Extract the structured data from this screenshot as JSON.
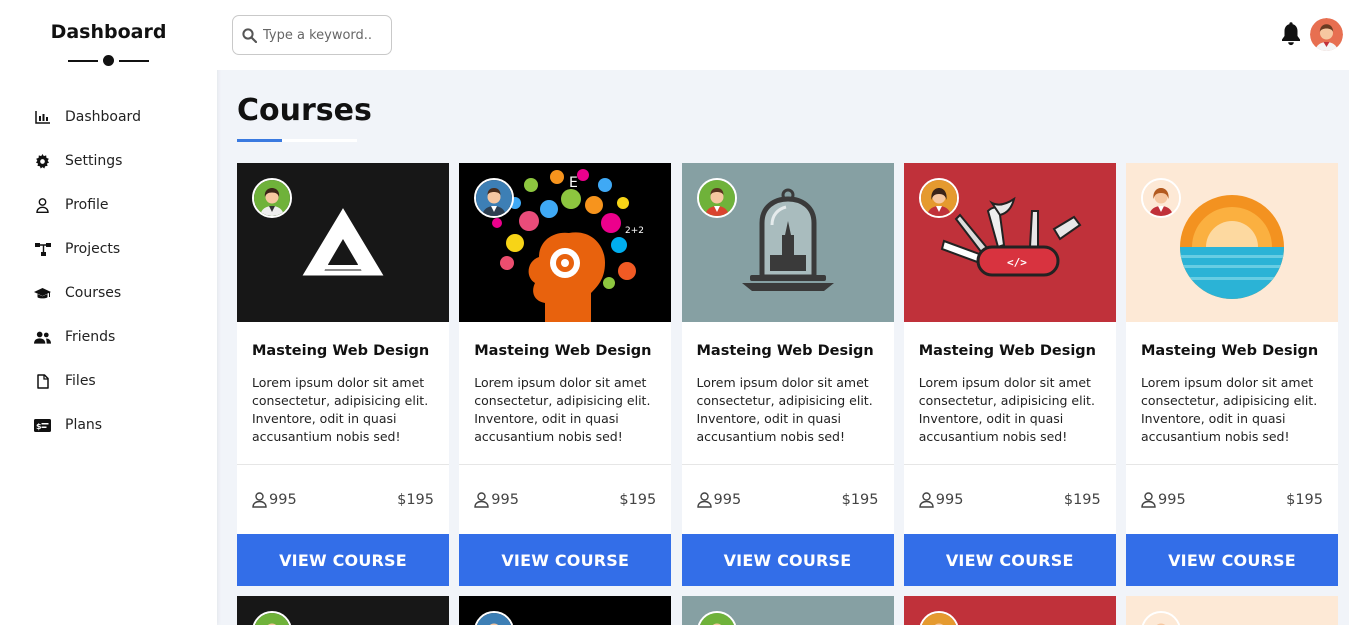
{
  "sidebar": {
    "brand": "Dashboard",
    "items": [
      {
        "label": "Dashboard",
        "icon": "bar-chart-icon"
      },
      {
        "label": "Settings",
        "icon": "gear-icon"
      },
      {
        "label": "Profile",
        "icon": "user-icon"
      },
      {
        "label": "Projects",
        "icon": "sitemap-icon"
      },
      {
        "label": "Courses",
        "icon": "graduation-cap-icon"
      },
      {
        "label": "Friends",
        "icon": "users-icon"
      },
      {
        "label": "Files",
        "icon": "file-icon"
      },
      {
        "label": "Plans",
        "icon": "credit-card-icon"
      }
    ]
  },
  "header": {
    "search_placeholder": "Type a keyword..",
    "notification_icon": "bell-icon",
    "avatar_icon": "user-avatar-icon"
  },
  "main": {
    "title": "Courses",
    "cards": [
      {
        "title": "Masteing Web Design",
        "description": "Lorem ipsum dolor sit amet consectetur, adipisicing elit. Inventore, odit in quasi accusantium nobis sed!",
        "students": "995",
        "price": "$195",
        "button": "VIEW COURSE",
        "theme": "#171717"
      },
      {
        "title": "Masteing Web Design",
        "description": "Lorem ipsum dolor sit amet consectetur, adipisicing elit. Inventore, odit in quasi accusantium nobis sed!",
        "students": "995",
        "price": "$195",
        "button": "VIEW COURSE",
        "theme": "#000000"
      },
      {
        "title": "Masteing Web Design",
        "description": "Lorem ipsum dolor sit amet consectetur, adipisicing elit. Inventore, odit in quasi accusantium nobis sed!",
        "students": "995",
        "price": "$195",
        "button": "VIEW COURSE",
        "theme": "#86a0a3"
      },
      {
        "title": "Masteing Web Design",
        "description": "Lorem ipsum dolor sit amet consectetur, adipisicing elit. Inventore, odit in quasi accusantium nobis sed!",
        "students": "995",
        "price": "$195",
        "button": "VIEW COURSE",
        "theme": "#c0313a"
      },
      {
        "title": "Masteing Web Design",
        "description": "Lorem ipsum dolor sit amet consectetur, adipisicing elit. Inventore, odit in quasi accusantium nobis sed!",
        "students": "995",
        "price": "$195",
        "button": "VIEW COURSE",
        "theme": "#fde9d6"
      }
    ]
  },
  "colors": {
    "accent": "#336ee8",
    "background": "#f1f4f9",
    "title_underline": "#3a7ae0"
  }
}
